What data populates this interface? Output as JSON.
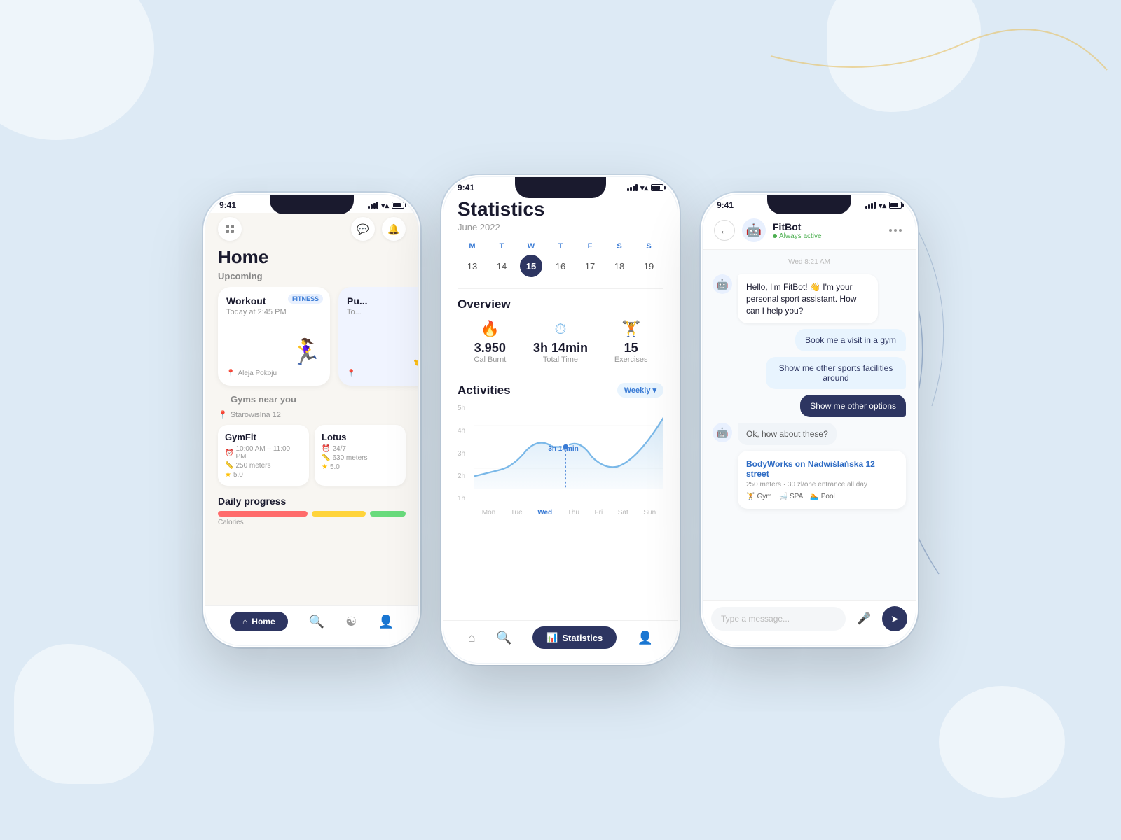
{
  "background": {
    "color": "#ddeaf5"
  },
  "phone_left": {
    "status": {
      "time": "9:41",
      "signal": true,
      "wifi": true,
      "battery": true
    },
    "header": {
      "title": "Home",
      "icons": [
        "grid",
        "chat",
        "bell"
      ]
    },
    "upcoming": {
      "label": "Upcoming",
      "cards": [
        {
          "title": "Workout",
          "time": "Today at 2:45 PM",
          "badge": "FITNESS",
          "location": "Aleja Pokoju",
          "emoji": "🏃"
        },
        {
          "title": "Pu...",
          "time": "To...",
          "location": "📍",
          "emoji": "🧘"
        }
      ]
    },
    "gyms": {
      "section_label": "Gyms near you",
      "location": "Starowislna 12",
      "items": [
        {
          "name": "GymFit",
          "hours": "10:00 AM – 11:00 PM",
          "distance": "250 meters",
          "rating": "5.0"
        },
        {
          "name": "Lotus",
          "hours": "24/7",
          "distance": "630 meters",
          "rating": "5.0"
        }
      ]
    },
    "daily_progress": {
      "label": "Daily progress",
      "sub": "Calories"
    },
    "nav": {
      "items": [
        {
          "label": "Home",
          "active": true
        },
        {
          "label": "Search",
          "active": false
        },
        {
          "label": "Activity",
          "active": false
        },
        {
          "label": "Profile",
          "active": false
        }
      ]
    }
  },
  "phone_center": {
    "status": {
      "time": "9:41"
    },
    "title": "Statistics",
    "month": "June 2022",
    "calendar": {
      "day_labels": [
        "M",
        "T",
        "W",
        "T",
        "F",
        "S",
        "S"
      ],
      "dates": [
        "13",
        "14",
        "15",
        "16",
        "17",
        "18",
        "19"
      ],
      "active_date": "15"
    },
    "overview": {
      "title": "Overview",
      "stats": [
        {
          "icon": "🔥",
          "value": "3.950",
          "label": "Cal Burnt"
        },
        {
          "icon": "⏱",
          "value": "3h 14min",
          "label": "Total Time"
        },
        {
          "icon": "🏋",
          "value": "15",
          "label": "Exercises"
        }
      ]
    },
    "activities": {
      "title": "Activities",
      "filter": "Weekly",
      "y_labels": [
        "5h",
        "4h",
        "3h",
        "2h",
        "1h"
      ],
      "x_labels": [
        "Mon",
        "Tue",
        "Wed",
        "Thu",
        "Fri",
        "Sat",
        "Sun"
      ],
      "annotation": "3h 14min",
      "annotation_day": "Wed"
    },
    "nav": {
      "items": [
        {
          "label": "Home",
          "active": false
        },
        {
          "label": "Search",
          "active": false
        },
        {
          "label": "Statistics",
          "active": true
        },
        {
          "label": "Profile",
          "active": false
        }
      ]
    }
  },
  "phone_right": {
    "status": {
      "time": "9:41"
    },
    "header": {
      "bot_name": "FitBot",
      "bot_status": "Always active"
    },
    "chat_date": "Wed 8:21 AM",
    "messages": [
      {
        "type": "bot",
        "text": "Hello, I'm FitBot! 👋 I'm your personal sport assistant. How can I help you?"
      },
      {
        "type": "user",
        "text": "Book me a visit in a gym",
        "style": "light"
      },
      {
        "type": "user",
        "text": "Show me other sports facilities around",
        "style": "light"
      },
      {
        "type": "user",
        "text": "Show me other options",
        "style": "dark"
      },
      {
        "type": "bot",
        "text": "Ok, how about these?"
      },
      {
        "type": "facility",
        "name": "BodyWorks on Nadwiślańska 12 street",
        "details": "250 meters · 30 zl/one entrance all day",
        "tags": [
          "Gym 🏋",
          "SPA 🛁",
          "Pool 🏊"
        ]
      }
    ],
    "input_placeholder": "Type a message...",
    "mic_icon": "🎤",
    "send_icon": "➤"
  }
}
